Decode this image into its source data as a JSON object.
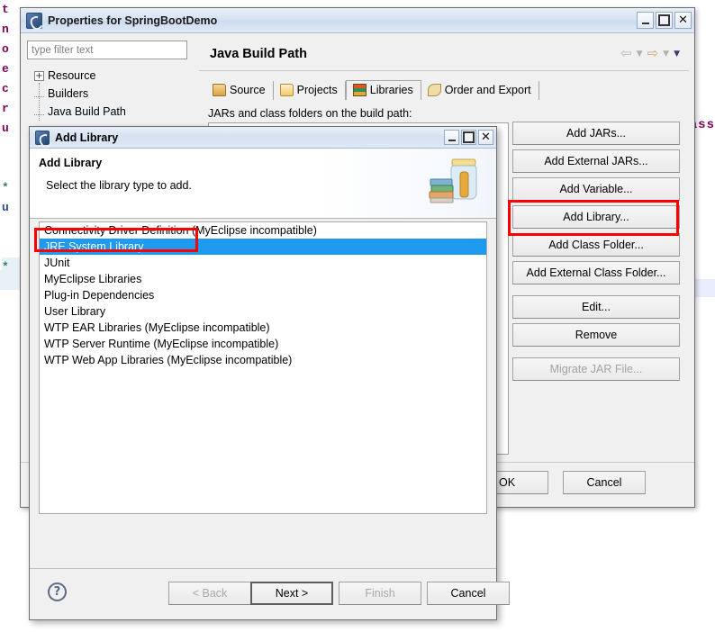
{
  "background_editor": {
    "left_gutter_chars": [
      "t",
      "n",
      "o",
      "e",
      "c",
      "r",
      "u",
      "*",
      "u",
      "*"
    ],
    "right_fragment": "ass"
  },
  "properties_dialog": {
    "title": "Properties for SpringBootDemo",
    "window_controls": {
      "minimize": "minimize-icon",
      "maximize": "maximize-icon",
      "close": "close-icon"
    },
    "filter": {
      "placeholder": "type filter text",
      "value": ""
    },
    "tree": [
      {
        "label": "Resource",
        "expander": "+"
      },
      {
        "label": "Builders",
        "expander": ""
      },
      {
        "label": "Java Build Path",
        "expander": "",
        "selected": true
      }
    ],
    "page_title": "Java Build Path",
    "nav": {
      "back": "back-arrow-icon",
      "back_menu": "chevron-down-icon",
      "forward": "forward-arrow-icon",
      "forward_menu": "chevron-down-icon",
      "view_menu": "chevron-down-icon"
    },
    "tabs": [
      {
        "label": "Source",
        "icon": "source-folder-icon",
        "active": false
      },
      {
        "label": "Projects",
        "icon": "projects-folder-icon",
        "active": false
      },
      {
        "label": "Libraries",
        "icon": "libraries-books-icon",
        "active": true
      },
      {
        "label": "Order and Export",
        "icon": "order-export-icon",
        "active": false
      }
    ],
    "jars_label": "JARs and class folders on the build path:",
    "side_buttons": [
      {
        "label": "Add JARs...",
        "enabled": true
      },
      {
        "label": "Add External JARs...",
        "enabled": true
      },
      {
        "label": "Add Variable...",
        "enabled": true
      },
      {
        "label": "Add Library...",
        "enabled": true,
        "highlighted": true
      },
      {
        "label": "Add Class Folder...",
        "enabled": true
      },
      {
        "label": "Add External Class Folder...",
        "enabled": true
      },
      {
        "label": "Edit...",
        "enabled": true,
        "gap": true
      },
      {
        "label": "Remove",
        "enabled": true
      },
      {
        "label": "Migrate JAR File...",
        "enabled": false,
        "gap": true
      }
    ],
    "footer": {
      "ok": "OK",
      "cancel": "Cancel"
    }
  },
  "add_library_dialog": {
    "title": "Add Library",
    "window_controls": {
      "minimize": "minimize-icon",
      "maximize": "maximize-icon",
      "close": "close-icon"
    },
    "heading": "Add Library",
    "subheading": "Select the library type to add.",
    "banner_icon": "jar-with-books-icon",
    "items": [
      {
        "label": "Connectivity Driver Definition (MyEclipse incompatible)",
        "selected": false
      },
      {
        "label": "JRE System Library",
        "selected": true
      },
      {
        "label": "JUnit",
        "selected": false
      },
      {
        "label": "MyEclipse Libraries",
        "selected": false
      },
      {
        "label": "Plug-in Dependencies",
        "selected": false
      },
      {
        "label": "User Library",
        "selected": false
      },
      {
        "label": "WTP EAR Libraries (MyEclipse incompatible)",
        "selected": false
      },
      {
        "label": "WTP Server Runtime (MyEclipse incompatible)",
        "selected": false
      },
      {
        "label": "WTP Web App Libraries (MyEclipse incompatible)",
        "selected": false
      }
    ],
    "help_icon": "?",
    "wizard_buttons": [
      {
        "label": "< Back",
        "enabled": false
      },
      {
        "label": "Next >",
        "enabled": true,
        "default": true
      },
      {
        "label": "Finish",
        "enabled": false
      },
      {
        "label": "Cancel",
        "enabled": true
      }
    ]
  },
  "annotations": {
    "highlight_color": "#ff0000",
    "boxes": [
      "add-library-button",
      "jre-system-library-item"
    ]
  }
}
